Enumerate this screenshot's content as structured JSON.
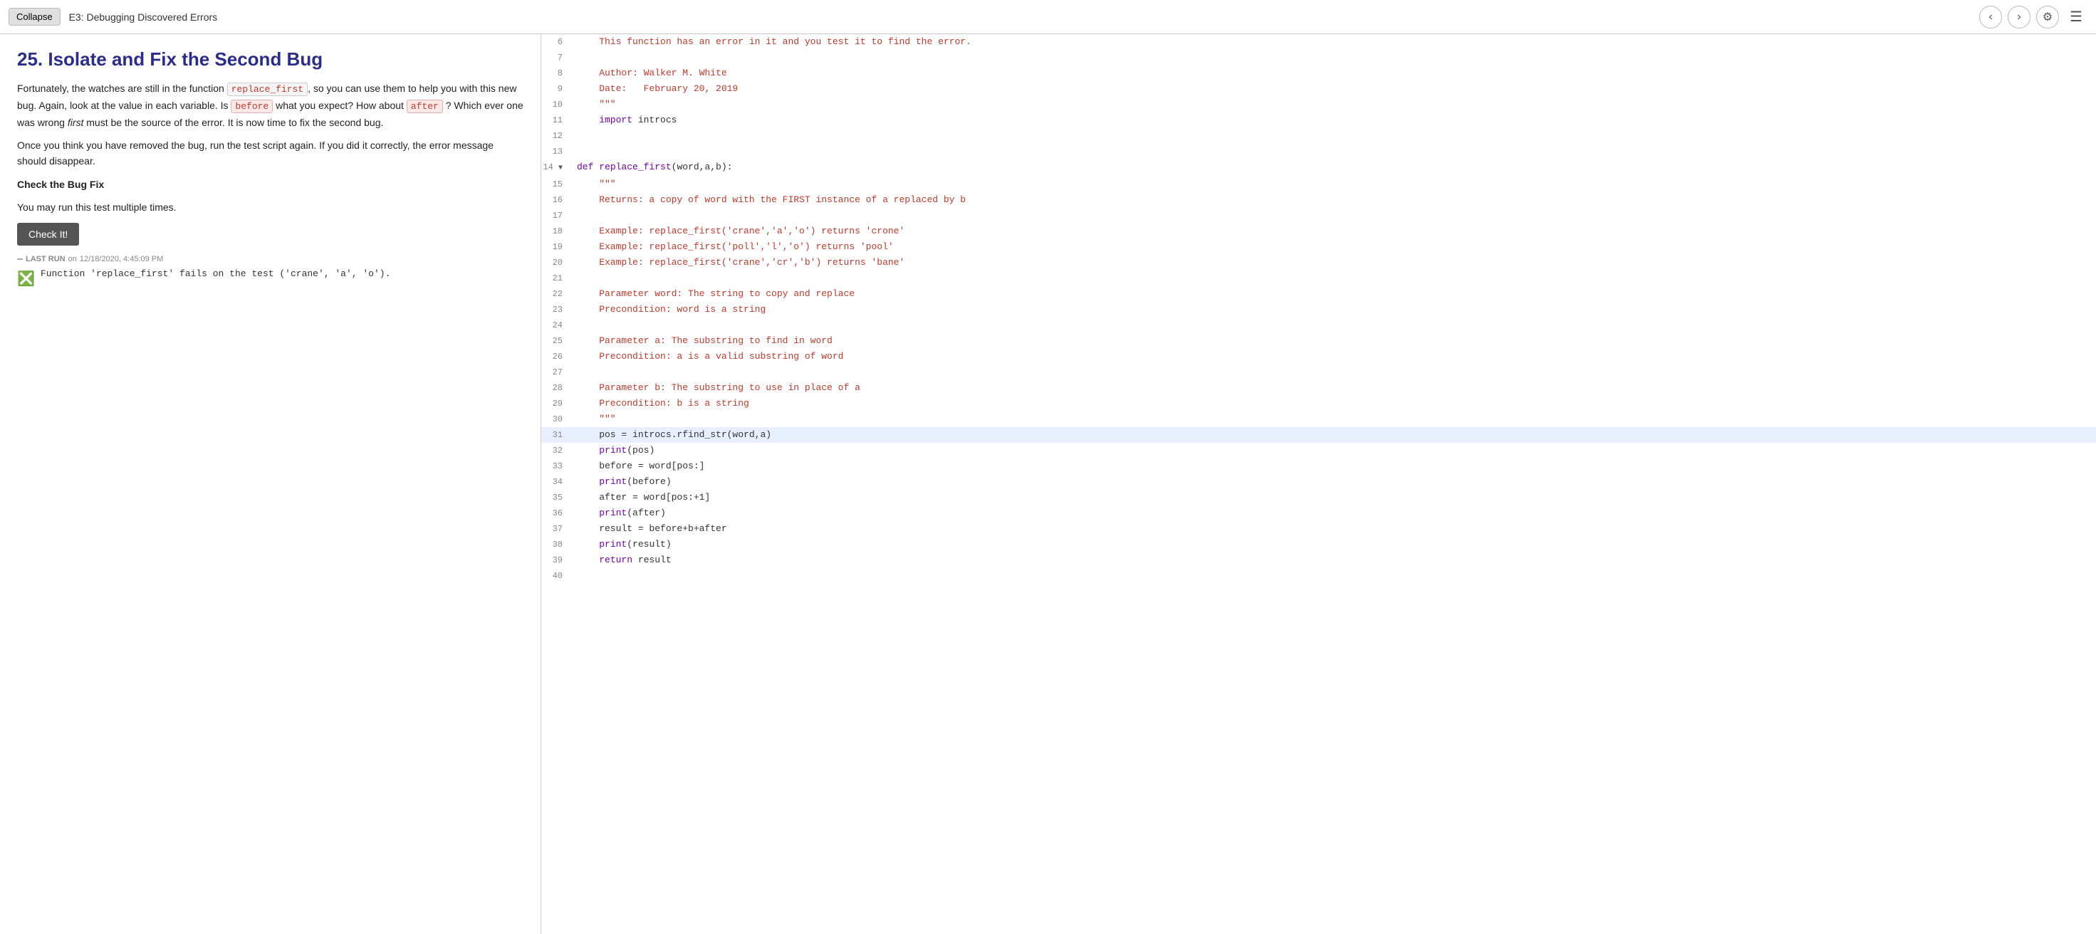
{
  "topbar": {
    "collapse_label": "Collapse",
    "title": "E3: Debugging Discovered Errors",
    "prev_icon": "‹",
    "next_icon": "›",
    "settings_icon": "⚙",
    "list_icon": "☰"
  },
  "left": {
    "heading": "25. Isolate and Fix the Second Bug",
    "para1_before": "Fortunately, the watches are still in the function ",
    "code_replace_first": "replace_first",
    "para1_after": ", so you can use them to help you with this new bug. Again, look at the value in each variable. Is ",
    "code_before": "before",
    "para1_after2": " what you expect? How about ",
    "code_after": "after",
    "para1_after3": " ? Which ever one was wrong ",
    "italic_first": "first",
    "para1_after4": " must be the source of the error. It is now time to fix the second bug.",
    "para2": "Once you think you have removed the bug, run the test script again. If you did it correctly, the error message should disappear.",
    "check_bug_fix_heading": "Check the Bug Fix",
    "check_run_text": "You may run this test multiple times.",
    "check_it_label": "Check It!",
    "last_run_prefix": "LAST RUN",
    "last_run_on": "on",
    "last_run_date": "12/18/2020, 4:45:09 PM",
    "result_text": "Function 'replace_first' fails on the test ('crane', 'a', 'o')."
  },
  "code": {
    "lines": [
      {
        "num": 6,
        "content": "    This function has an error in it and you test it to find the error.",
        "type": "comment"
      },
      {
        "num": 7,
        "content": "",
        "type": "plain"
      },
      {
        "num": 8,
        "content": "    Author: Walker M. White",
        "type": "comment"
      },
      {
        "num": 9,
        "content": "    Date:   February 20, 2019",
        "type": "comment"
      },
      {
        "num": 10,
        "content": "    \"\"\"",
        "type": "comment"
      },
      {
        "num": 11,
        "content": "    import introcs",
        "type": "import"
      },
      {
        "num": 12,
        "content": "",
        "type": "plain"
      },
      {
        "num": 13,
        "content": "",
        "type": "plain"
      },
      {
        "num": 14,
        "content": "def replace_first(word,a,b):",
        "type": "def",
        "arrow": true
      },
      {
        "num": 15,
        "content": "    \"\"\"",
        "type": "comment"
      },
      {
        "num": 16,
        "content": "    Returns: a copy of word with the FIRST instance of a replaced by b",
        "type": "comment"
      },
      {
        "num": 17,
        "content": "",
        "type": "plain"
      },
      {
        "num": 18,
        "content": "    Example: replace_first('crane','a','o') returns 'crone'",
        "type": "comment"
      },
      {
        "num": 19,
        "content": "    Example: replace_first('poll','l','o') returns 'pool'",
        "type": "comment"
      },
      {
        "num": 20,
        "content": "    Example: replace_first('crane','cr','b') returns 'bane'",
        "type": "comment"
      },
      {
        "num": 21,
        "content": "",
        "type": "plain"
      },
      {
        "num": 22,
        "content": "    Parameter word: The string to copy and replace",
        "type": "comment"
      },
      {
        "num": 23,
        "content": "    Precondition: word is a string",
        "type": "comment"
      },
      {
        "num": 24,
        "content": "",
        "type": "plain"
      },
      {
        "num": 25,
        "content": "    Parameter a: The substring to find in word",
        "type": "comment"
      },
      {
        "num": 26,
        "content": "    Precondition: a is a valid substring of word",
        "type": "comment"
      },
      {
        "num": 27,
        "content": "",
        "type": "plain"
      },
      {
        "num": 28,
        "content": "    Parameter b: The substring to use in place of a",
        "type": "comment"
      },
      {
        "num": 29,
        "content": "    Precondition: b is a string",
        "type": "comment"
      },
      {
        "num": 30,
        "content": "    \"\"\"",
        "type": "comment"
      },
      {
        "num": 31,
        "content": "    pos = introcs.rfind_str(word,a)",
        "type": "code",
        "highlighted": true
      },
      {
        "num": 32,
        "content": "    print(pos)",
        "type": "code"
      },
      {
        "num": 33,
        "content": "    before = word[pos:]",
        "type": "code"
      },
      {
        "num": 34,
        "content": "    print(before)",
        "type": "code"
      },
      {
        "num": 35,
        "content": "    after = word[pos:+1]",
        "type": "code"
      },
      {
        "num": 36,
        "content": "    print(after)",
        "type": "code"
      },
      {
        "num": 37,
        "content": "    result = before+b+after",
        "type": "code"
      },
      {
        "num": 38,
        "content": "    print(result)",
        "type": "code"
      },
      {
        "num": 39,
        "content": "    return result",
        "type": "code"
      },
      {
        "num": 40,
        "content": "",
        "type": "plain"
      }
    ]
  }
}
